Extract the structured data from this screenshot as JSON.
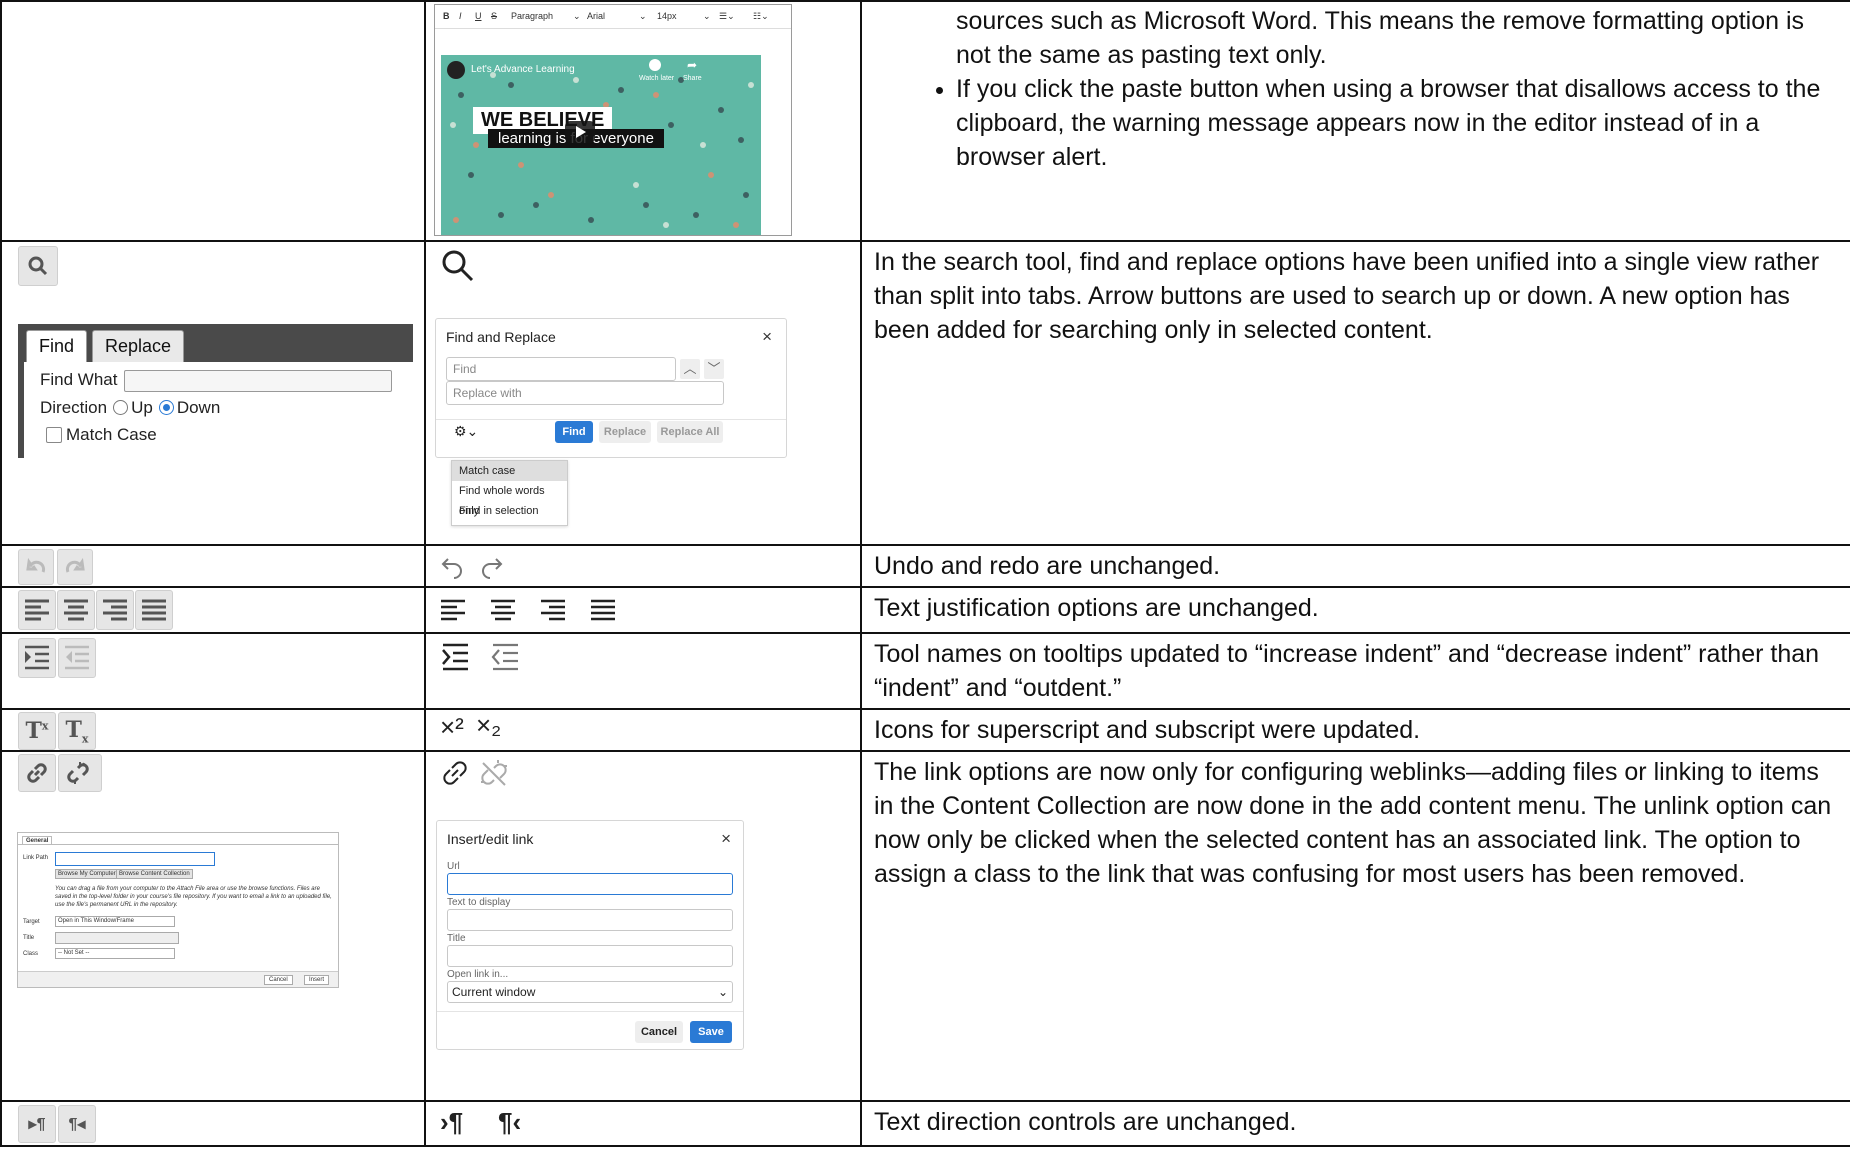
{
  "row1": {
    "description_items": [
      "sources such as Microsoft Word. This means the remove formatting option is not the same as pasting text only.",
      "If you click the paste button when using a browser that disallows access to the clipboard, the warning message appears now in the editor instead of in a browser alert."
    ],
    "editor_toolbar": {
      "bold": "B",
      "italic": "I",
      "underline": "U",
      "strike": "S",
      "block_format": "Paragraph",
      "font_family": "Arial",
      "font_size": "14px"
    },
    "video": {
      "channel": "Let's Advance Learning",
      "watch_later": "Watch later",
      "share": "Share",
      "headline": "WE BELIEVE",
      "subline": "learning is for everyone"
    }
  },
  "row2": {
    "description": "In the search tool, find and replace options have been unified into a single view rather than split into tabs. Arrow buttons are used to search up or down. A new option has been added for searching only in selected content.",
    "old_find": {
      "tab_find": "Find",
      "tab_replace": "Replace",
      "find_what": "Find What",
      "direction": "Direction",
      "up": "Up",
      "down": "Down",
      "match_case": "Match Case"
    },
    "new_find": {
      "title": "Find and Replace",
      "close": "×",
      "find_placeholder": "Find",
      "replace_placeholder": "Replace with",
      "find_btn": "Find",
      "replace_btn": "Replace",
      "replace_all_btn": "Replace All",
      "menu": [
        "Match case",
        "Find whole words only",
        "Find in selection"
      ]
    }
  },
  "row3": {
    "description": "Undo and redo are unchanged."
  },
  "row4": {
    "description": "Text justification options are unchanged."
  },
  "row5": {
    "description": "Tool names on tooltips updated to “increase indent” and “decrease indent” rather than “indent” and “outdent.”"
  },
  "row6": {
    "description": "Icons for superscript and subscript were updated.",
    "old_sup": "T",
    "old_sup_mark": "x",
    "old_sub": "T",
    "old_sub_mark": "x",
    "new_sup": "×²",
    "new_sub": "×₂"
  },
  "row7": {
    "description": "The link options are now only for configuring weblinks—adding files or linking to items in the Content Collection are now done in the add content menu. The unlink option can now only be clicked when the selected content has an associated link. The option to assign a class to the link that was confusing for most users has been removed.",
    "old_link": {
      "tab": "General",
      "link_path": "Link Path",
      "browse_computer": "Browse My Computer",
      "browse_collection": "Browse Content Collection",
      "help_text": "You can drag a file from your computer to the Attach File area or use the browse functions. Files are saved in the top-level folder in your course's file repository. If you want to email a link to an uploaded file, use the file's permanent URL in the repository.",
      "target": "Target",
      "target_value": "Open in This Window/Frame",
      "title": "Title",
      "class": "Class",
      "class_value": "-- Not Set --",
      "cancel": "Cancel",
      "insert": "Insert"
    },
    "new_link": {
      "title": "Insert/edit link",
      "close": "×",
      "url": "Url",
      "text_to_display": "Text to display",
      "title_field": "Title",
      "open_link_in": "Open link in...",
      "open_value": "Current window",
      "cancel": "Cancel",
      "save": "Save"
    }
  },
  "row8": {
    "description": "Text direction controls are unchanged.",
    "ltr": "▸¶",
    "rtl": "¶◂",
    "new_ltr": "›¶",
    "new_rtl": "¶‹"
  },
  "colors": {
    "accent_blue": "#2a7ad5",
    "dark_bar": "#4a4a4a"
  }
}
